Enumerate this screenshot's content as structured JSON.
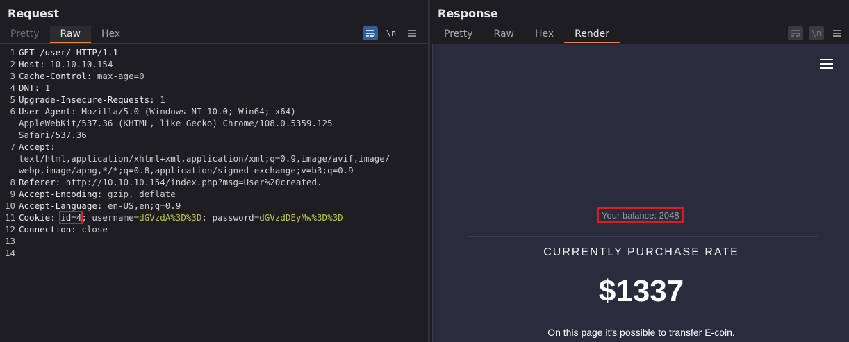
{
  "request": {
    "title": "Request",
    "tabs": [
      "Pretty",
      "Raw",
      "Hex"
    ],
    "active_tab": "Raw",
    "toolbar": {
      "newline_label": "\\n"
    },
    "lines": [
      {
        "num": "1",
        "key": "GET /user/ HTTP/1.1",
        "val": ""
      },
      {
        "num": "2",
        "key": "Host: ",
        "val": "10.10.10.154"
      },
      {
        "num": "3",
        "key": "Cache-Control: ",
        "val": "max-age=0"
      },
      {
        "num": "4",
        "key": "DNT: ",
        "val": "1"
      },
      {
        "num": "5",
        "key": "Upgrade-Insecure-Requests: ",
        "val": "1"
      },
      {
        "num": "6",
        "key": "User-Agent: ",
        "val": "Mozilla/5.0 (Windows NT 10.0; Win64; x64)"
      },
      {
        "num": "",
        "key": "",
        "val": "AppleWebKit/537.36 (KHTML, like Gecko) Chrome/108.0.5359.125"
      },
      {
        "num": "",
        "key": "",
        "val": "Safari/537.36"
      },
      {
        "num": "7",
        "key": "Accept: ",
        "val": ""
      },
      {
        "num": "",
        "key": "",
        "val": "text/html,application/xhtml+xml,application/xml;q=0.9,image/avif,image/"
      },
      {
        "num": "",
        "key": "",
        "val": "webp,image/apng,*/*;q=0.8,application/signed-exchange;v=b3;q=0.9"
      },
      {
        "num": "8",
        "key": "Referer: ",
        "val": "http://10.10.10.154/index.php?msg=User%20created."
      },
      {
        "num": "9",
        "key": "Accept-Encoding: ",
        "val": "gzip, deflate"
      },
      {
        "num": "10",
        "key": "Accept-Language: ",
        "val": "en-US,en;q=0.9"
      },
      {
        "num": "11",
        "key": "Cookie: ",
        "val": ""
      },
      {
        "num": "12",
        "key": "Connection: ",
        "val": "close"
      },
      {
        "num": "13",
        "key": "",
        "val": ""
      },
      {
        "num": "14",
        "key": "",
        "val": ""
      }
    ],
    "cookie": {
      "id_part": "id=4",
      "sep1": ";",
      "username_key": " username=",
      "username_val": "dGVzdA%3D%3D",
      "sep2": "; ",
      "password_key": "password=",
      "password_val": "dGVzdDEyMw%3D%3D"
    }
  },
  "response": {
    "title": "Response",
    "tabs": [
      "Pretty",
      "Raw",
      "Hex",
      "Render"
    ],
    "active_tab": "Render",
    "toolbar": {
      "newline_label": "\\n"
    },
    "render": {
      "balance": "Your balance: 2048",
      "rate_title": "CURRENTLY PURCHASE RATE",
      "rate_value": "$1337",
      "transfer_text": "On this page it's possible to transfer E-coin."
    }
  },
  "colors": {
    "accent": "#e8833a",
    "highlight": "#e01b1b",
    "cookie_value": "#b8c94a",
    "render_bg": "#2a2c3e",
    "active_toggle": "#2f5f9e"
  }
}
